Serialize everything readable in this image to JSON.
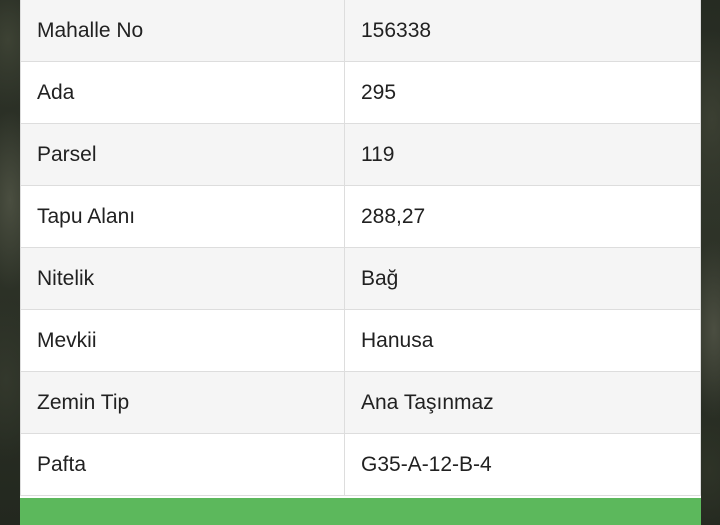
{
  "rows": [
    {
      "label": "Mahalle No",
      "value": "156338"
    },
    {
      "label": "Ada",
      "value": "295"
    },
    {
      "label": "Parsel",
      "value": "119"
    },
    {
      "label": "Tapu Alanı",
      "value": "288,27"
    },
    {
      "label": "Nitelik",
      "value": "Bağ"
    },
    {
      "label": "Mevkii",
      "value": "Hanusa"
    },
    {
      "label": "Zemin Tip",
      "value": "Ana Taşınmaz"
    },
    {
      "label": "Pafta",
      "value": "G35-A-12-B-4"
    }
  ],
  "colors": {
    "accent_green": "#5cb85c",
    "stripe": "#f5f5f5"
  }
}
